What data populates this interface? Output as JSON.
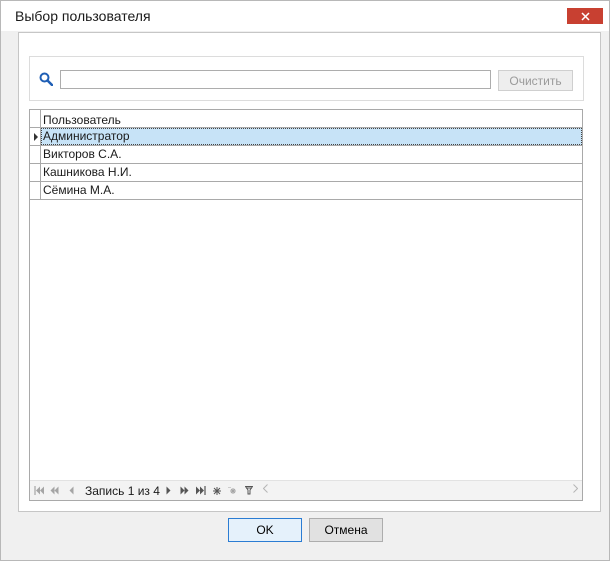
{
  "window": {
    "title": "Выбор пользователя"
  },
  "search": {
    "value": "",
    "placeholder": "",
    "clear_label": "Очистить"
  },
  "grid": {
    "column_header": "Пользователь",
    "rows": [
      {
        "name": "Администратор",
        "selected": true
      },
      {
        "name": "Викторов С.А.",
        "selected": false
      },
      {
        "name": "Кашникова Н.И.",
        "selected": false
      },
      {
        "name": "Сёмина М.А.",
        "selected": false
      }
    ],
    "navigator": {
      "record_text": "Запись 1 из 4"
    }
  },
  "buttons": {
    "ok_label": "OK",
    "cancel_label": "Отмена"
  },
  "colors": {
    "close_button": "#c84031",
    "selection": "#c7e3f7",
    "ok_border": "#2b7cd3",
    "search_icon": "#1f5fb5"
  },
  "icons": {
    "search": "search-icon",
    "close": "close-icon"
  }
}
